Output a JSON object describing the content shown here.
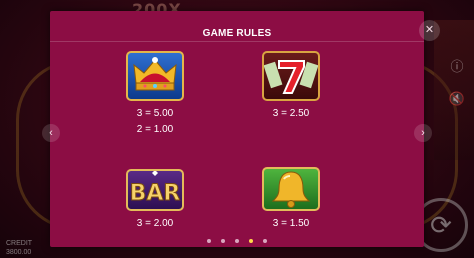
{
  "background": {
    "sign_text": "200X",
    "hud_label": "CREDIT",
    "hud_value": "3800.00"
  },
  "modal": {
    "title": "GAME RULES",
    "close_icon": "close-icon",
    "prev_icon": "chevron-left-icon",
    "next_icon": "chevron-right-icon"
  },
  "symbols": [
    {
      "name": "crown",
      "paylines": [
        "3 = 5.00",
        "2 = 1.00"
      ]
    },
    {
      "name": "seven",
      "paylines": [
        "3 = 2.50"
      ]
    },
    {
      "name": "bar",
      "label": "BAR",
      "paylines": [
        "3 = 2.00"
      ]
    },
    {
      "name": "bell",
      "paylines": [
        "3 = 1.50"
      ]
    }
  ],
  "pagination": {
    "total": 5,
    "active": 4
  },
  "colors": {
    "modal_bg": "#8c0d44",
    "active_dot": "#ffd84a"
  }
}
